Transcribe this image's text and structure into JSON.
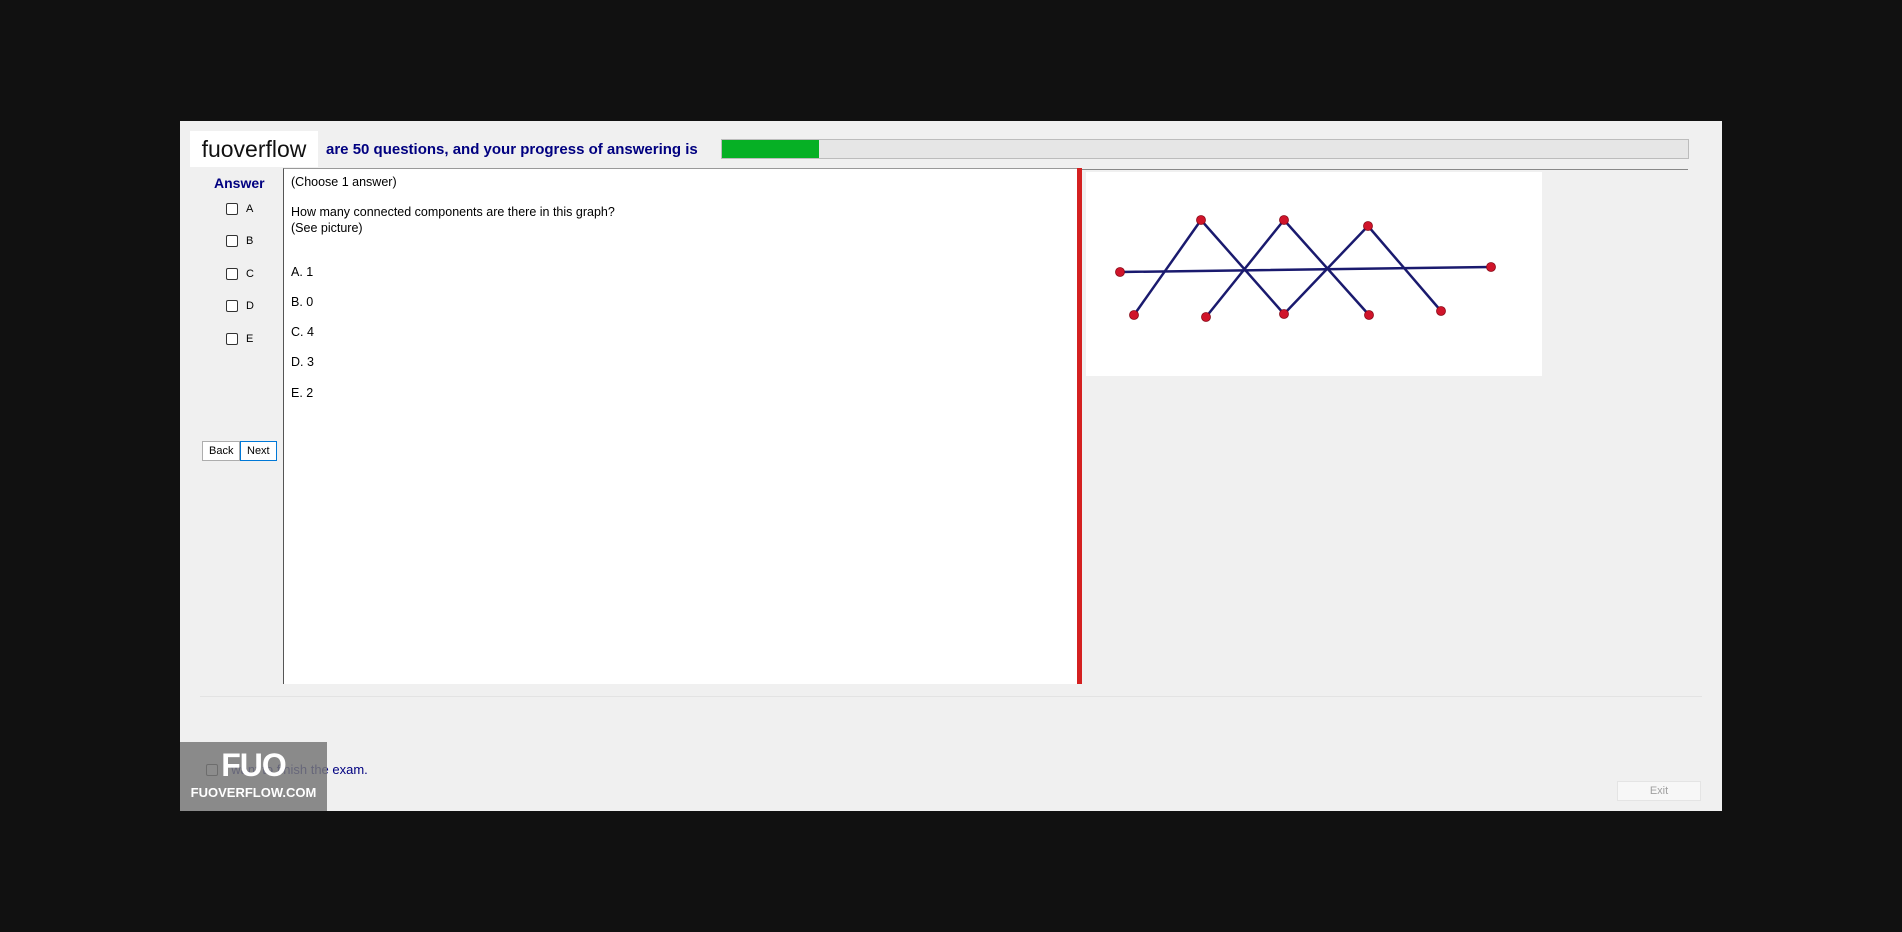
{
  "window": {
    "logo": "fuoverflow",
    "progress_label": "are 50 questions, and your progress of answering is",
    "progress_fraction": 0.1
  },
  "answer_panel": {
    "title": "Answer",
    "options": [
      "A",
      "B",
      "C",
      "D",
      "E"
    ],
    "back_label": "Back",
    "next_label": "Next"
  },
  "question": {
    "instruction": "(Choose 1 answer)",
    "text": "How many connected components are there in this graph?",
    "note": "(See picture)",
    "choices": [
      "A.  1",
      "B.  0",
      "C.  4",
      "D.  3",
      "E.  2"
    ]
  },
  "footer": {
    "finish_label": "I want to finish the exam.",
    "exit_label": "Exit"
  },
  "watermark": {
    "badge_big": "FUO",
    "badge_small": "FUOVERFLOW.COM"
  },
  "colors": {
    "progress": "#06b025",
    "splitter": "#d42020",
    "edge": "#1a1a6e",
    "vertex": "#d0142a"
  }
}
